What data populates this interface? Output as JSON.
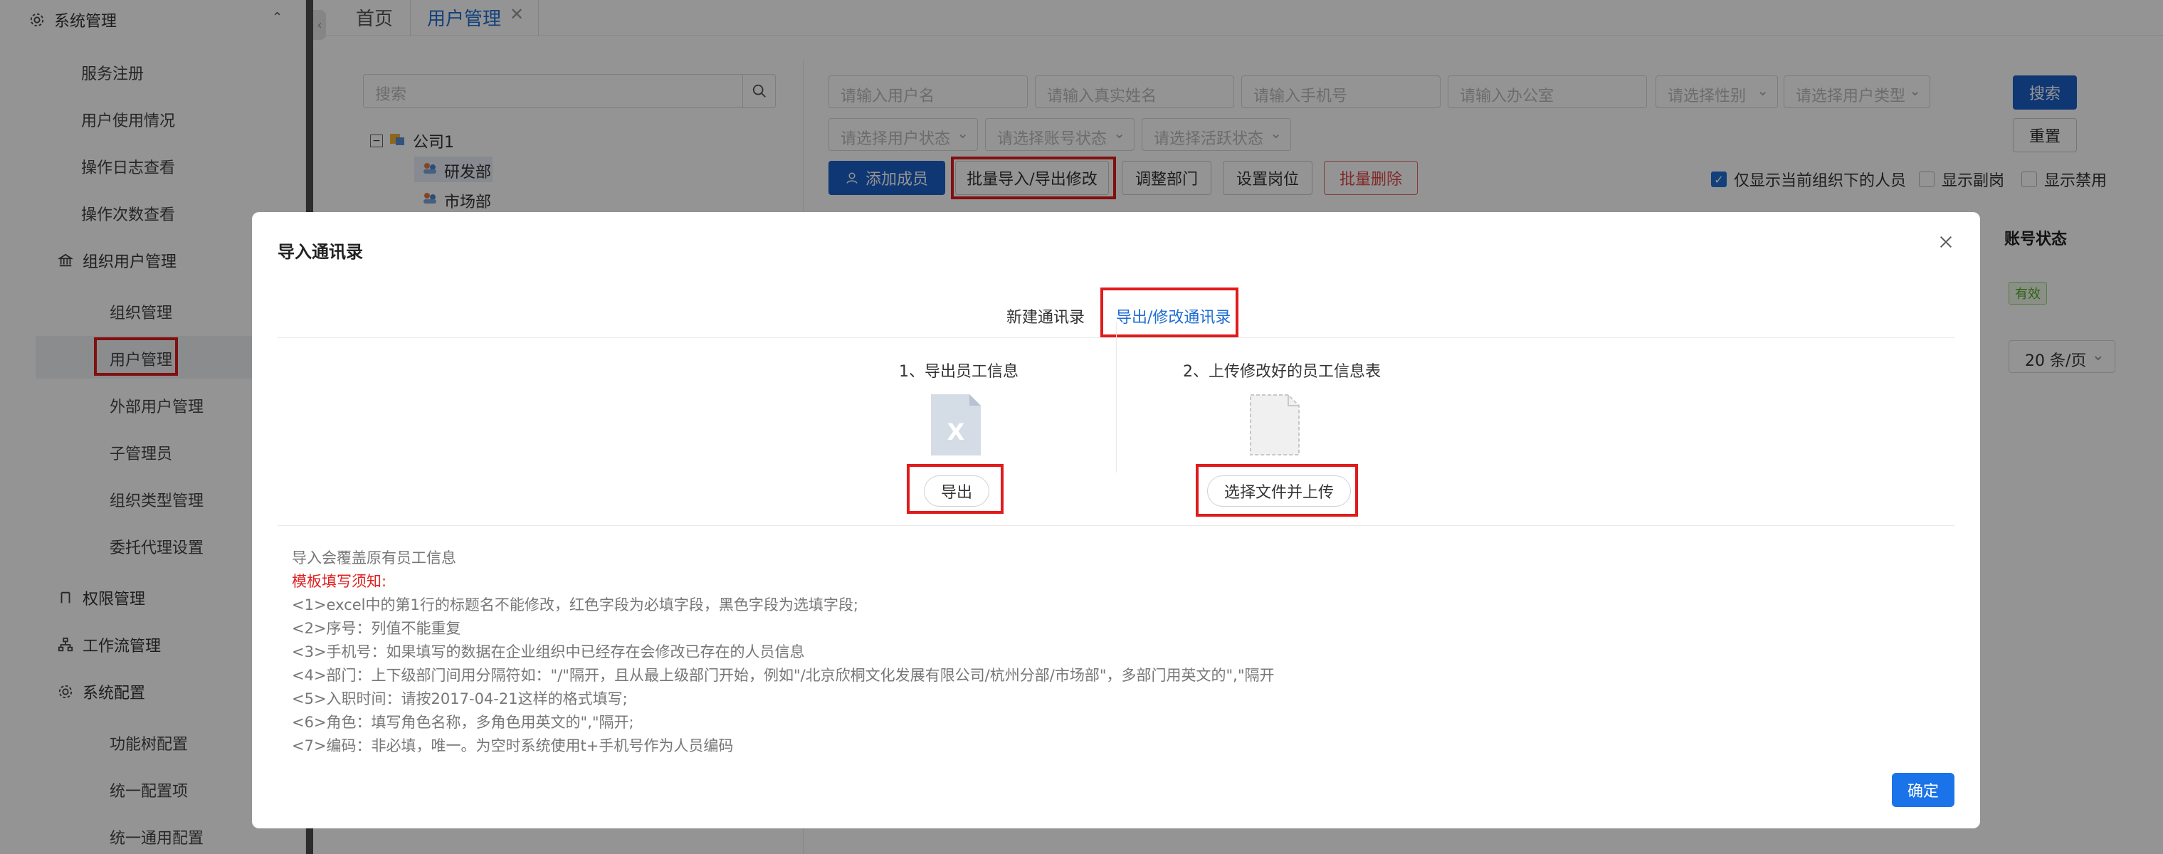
{
  "sidebar": {
    "system_group": "系统管理",
    "items_top": [
      "服务注册",
      "用户使用情况",
      "操作日志查看",
      "操作次数查看"
    ],
    "org_group": "组织用户管理",
    "org_items": [
      "组织管理",
      "用户管理",
      "外部用户管理",
      "子管理员",
      "组织类型管理",
      "委托代理设置"
    ],
    "perm_group": "权限管理",
    "workflow_group": "工作流管理",
    "config_group": "系统配置",
    "config_items": [
      "功能树配置",
      "统一配置项",
      "统一通用配置"
    ]
  },
  "tabs": {
    "home": "首页",
    "user_mgmt": "用户管理"
  },
  "tree": {
    "search_placeholder": "搜索",
    "root": "公司1",
    "children": [
      "研发部",
      "市场部"
    ]
  },
  "filters": {
    "username": "请输入用户名",
    "realname": "请输入真实姓名",
    "phone": "请输入手机号",
    "office": "请输入办公室",
    "gender": "请选择性别",
    "user_type": "请选择用户类型",
    "user_status": "请选择用户状态",
    "account_status": "请选择账号状态",
    "active_status": "请选择活跃状态",
    "search_btn": "搜索",
    "reset_btn": "重置"
  },
  "actions": {
    "add_member": "添加成员",
    "batch_import": "批量导入/导出修改",
    "adjust_dept": "调整部门",
    "set_post": "设置岗位",
    "batch_delete": "批量删除"
  },
  "checks": {
    "only_current": "仅显示当前组织下的人员",
    "show_deputy": "显示副岗",
    "show_disabled": "显示禁用"
  },
  "table": {
    "col_account_status": "账号状态",
    "status_value": "有效",
    "page_size": "20 条/页"
  },
  "modal": {
    "title": "导入通讯录",
    "tab_new": "新建通讯录",
    "tab_export": "导出/修改通讯录",
    "step1": "1、导出员工信息",
    "step2": "2、上传修改好的员工信息表",
    "export_btn": "导出",
    "upload_btn": "选择文件并上传",
    "notes": [
      "导入会覆盖原有员工信息",
      "模板填写须知:",
      "<1>excel中的第1行的标题名不能修改，红色字段为必填字段，黑色字段为选填字段;",
      "<2>序号：列值不能重复",
      "<3>手机号：如果填写的数据在企业组织中已经存在会修改已存在的人员信息",
      "<4>部门：上下级部门间用分隔符如：\"/\"隔开，且从最上级部门开始，例如\"/北京欣桐文化发展有限公司/杭州分部/市场部\"，多部门用英文的\",\"隔开",
      "<5>入职时间：请按2017-04-21这样的格式填写;",
      "<6>角色：填写角色名称，多角色用英文的\",\"隔开;",
      "<7>编码：非必填，唯一。为空时系统使用t+手机号作为人员编码"
    ],
    "ok_btn": "确定"
  },
  "colors": {
    "primary": "#1a5fc6",
    "highlight_box": "#e01b1b",
    "danger": "#e04848",
    "excel_icon": "#d4dce6"
  }
}
